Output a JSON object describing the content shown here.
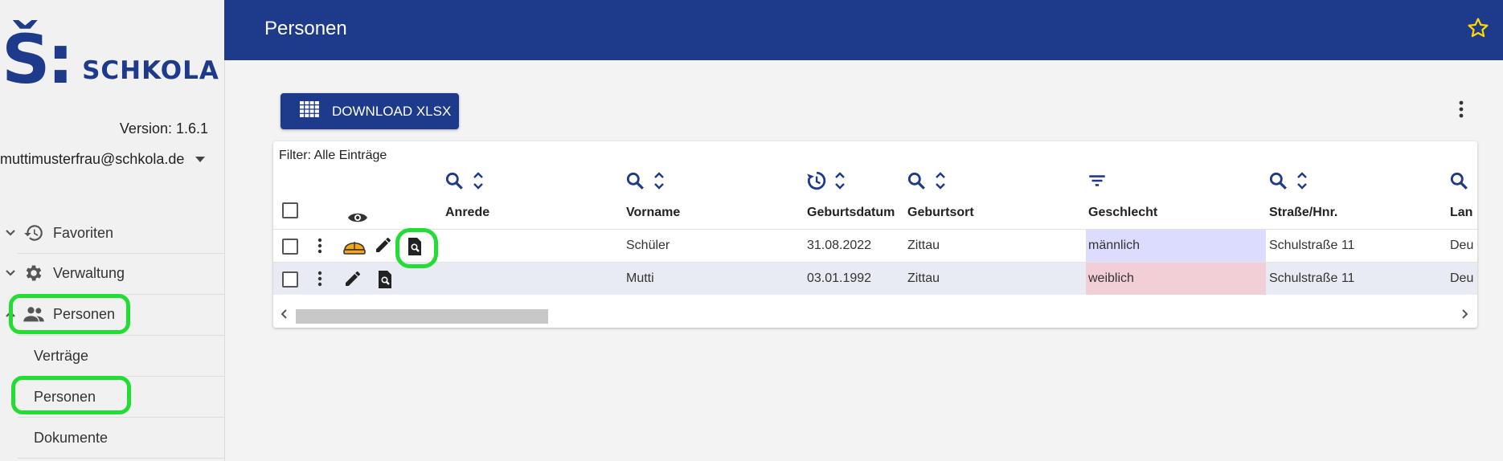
{
  "sidebar": {
    "logo_mark": "Š:",
    "logo_text": "SCHKOLA",
    "version": "Version: 1.6.1",
    "user": "muttimusterfrau@schkola.de",
    "items": [
      {
        "label": "Favoriten",
        "icon": "history-icon"
      },
      {
        "label": "Verwaltung",
        "icon": "gear-icon"
      },
      {
        "label": "Personen",
        "icon": "people-icon"
      }
    ],
    "subitems": [
      "Verträge",
      "Personen",
      "Dokumente"
    ]
  },
  "header": {
    "title": "Personen"
  },
  "toolbar": {
    "download_label": "DOWNLOAD XLSX"
  },
  "table": {
    "filter": "Filter: Alle Einträge",
    "columns": [
      "Anrede",
      "Vorname",
      "Geburtsdatum",
      "Geburtsort",
      "Geschlecht",
      "Straße/Hnr.",
      "Lan"
    ],
    "rows": [
      {
        "anrede": "",
        "vorname": "Schüler",
        "geburtsdatum": "31.08.2022",
        "geburtsort": "Zittau",
        "geschlecht": "männlich",
        "strasse": "Schulstraße 11",
        "land": "Deu"
      },
      {
        "anrede": "",
        "vorname": "Mutti",
        "geburtsdatum": "03.01.1992",
        "geburtsort": "Zittau",
        "geschlecht": "weiblich",
        "strasse": "Schulstraße 11",
        "land": "Deu"
      }
    ]
  },
  "colors": {
    "primary": "#1e3a8a",
    "highlight": "#22dd33",
    "male_bg": "#dcdcff",
    "female_bg": "#f2cfd6"
  }
}
